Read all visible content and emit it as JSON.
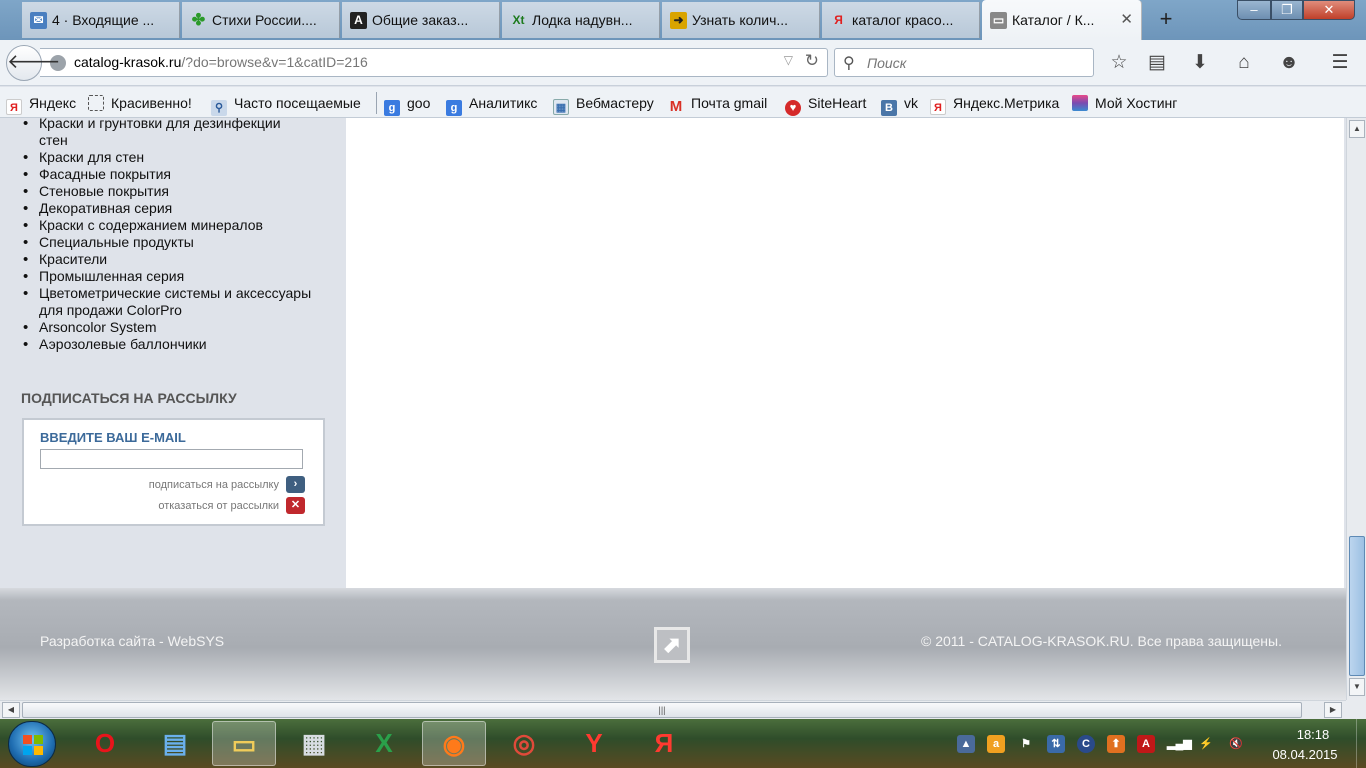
{
  "window": {
    "tabs": [
      {
        "label": "4 · Входящие ...",
        "icon": "mail-icon",
        "color": "#4a7fc0"
      },
      {
        "label": "Стихи России....",
        "icon": "clover-icon",
        "color": "#2a9a2a"
      },
      {
        "label": "Общие заказ...",
        "icon": "a-letter-icon",
        "color": "#222222"
      },
      {
        "label": "Лодка надувн...",
        "icon": "xt-icon",
        "color": "#1c7a1c"
      },
      {
        "label": "Узнать колич...",
        "icon": "arrow-doc-icon",
        "color": "#d9a400"
      },
      {
        "label": "каталог красо...",
        "icon": "yandex-icon",
        "color": "#e02020"
      },
      {
        "label": "Каталог / К...",
        "icon": "page-icon",
        "color": "#777777"
      }
    ],
    "new_tab": "+",
    "controls": {
      "minimize": "–",
      "maximize": "❐",
      "close": "✕"
    }
  },
  "navbar": {
    "url_host": "catalog-krasok.ru",
    "url_path": "/?do=browse&v=1&catID=216",
    "search_placeholder": "Поиск",
    "toolbar_icons": [
      "star-icon",
      "reading-list-icon",
      "download-icon",
      "home-icon",
      "chat-icon",
      "menu-icon"
    ]
  },
  "bookmarks": [
    {
      "label": "Яндекс",
      "icon": "yandex-icon"
    },
    {
      "label": "Красивенно!",
      "icon": "dotted-square-icon"
    },
    {
      "label": "Часто посещаемые",
      "icon": "search-folder-icon"
    },
    {
      "label": "goo",
      "icon": "google-icon"
    },
    {
      "label": "Аналитикс",
      "icon": "google-icon"
    },
    {
      "label": "Вебмастеру",
      "icon": "calendar-icon"
    },
    {
      "label": "Почта gmail",
      "icon": "gmail-icon"
    },
    {
      "label": "SiteHeart",
      "icon": "siteheart-icon"
    },
    {
      "label": "vk",
      "icon": "vk-icon"
    },
    {
      "label": "Яндекс.Метрика",
      "icon": "yandex-icon"
    },
    {
      "label": "Мой Хостинг",
      "icon": "stack-icon"
    }
  ],
  "sidebar": {
    "categories": [
      "Краски и грунтовки для дезинфекции стен",
      "Краски для стен",
      "Фасадные покрытия",
      "Стеновые покрытия",
      "Декоративная серия",
      "Краски с содержанием минералов",
      "Специальные продукты",
      "Красители",
      "Промышленная серия",
      "Цветометрические системы и аксессуары для продажи ColorPro",
      "Arsoncolor System",
      "Аэрозолевые баллончики"
    ],
    "subscribe": {
      "heading": "ПОДПИСАТЬСЯ НА РАССЫЛКУ",
      "email_label": "ВВЕДИТЕ ВАШ E-MAIL",
      "email_value": "",
      "subscribe_link": "подписаться на рассылку",
      "unsubscribe_link": "отказаться от рассылки"
    }
  },
  "footer": {
    "left": "Разработка сайта - WebSYS",
    "right": "© 2011 - CATALOG-KRASOK.RU. Все права защищены."
  },
  "taskbar": {
    "apps": [
      {
        "name": "opera-icon",
        "glyph": "O",
        "color": "#e8141b"
      },
      {
        "name": "control-panel-icon",
        "glyph": "▤",
        "color": "#3a8bd6"
      },
      {
        "name": "explorer-icon",
        "glyph": "▭",
        "color": "#e9c255"
      },
      {
        "name": "calculator-icon",
        "glyph": "▦",
        "color": "#b8c2cc"
      },
      {
        "name": "excel-icon",
        "glyph": "X",
        "color": "#1d7a3a"
      },
      {
        "name": "firefox-icon",
        "glyph": "◉",
        "color": "#e86a1a"
      },
      {
        "name": "chrome-icon",
        "glyph": "◎",
        "color": "#d93b30"
      },
      {
        "name": "yandex-browser-icon",
        "glyph": "Y",
        "color": "#e52620"
      },
      {
        "name": "yandex-icon",
        "glyph": "Я",
        "color": "#e52620"
      }
    ],
    "clock_time": "18:18",
    "clock_date": "08.04.2015"
  }
}
